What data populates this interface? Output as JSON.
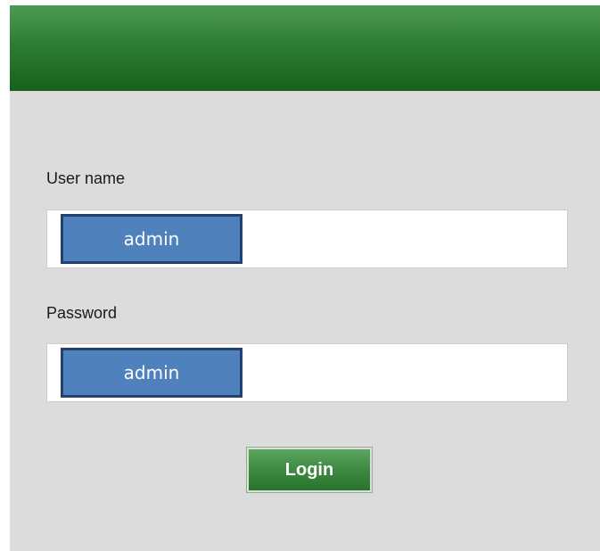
{
  "form": {
    "username_label": "User name",
    "username_value": "admin",
    "password_label": "Password",
    "password_value": "admin",
    "login_label": "Login"
  },
  "colors": {
    "header_green": "#2f7d34",
    "panel_background": "#dcdcdc",
    "highlight_fill": "#4f81bd",
    "highlight_border": "#24406e",
    "button_green": "#3c8a40"
  }
}
